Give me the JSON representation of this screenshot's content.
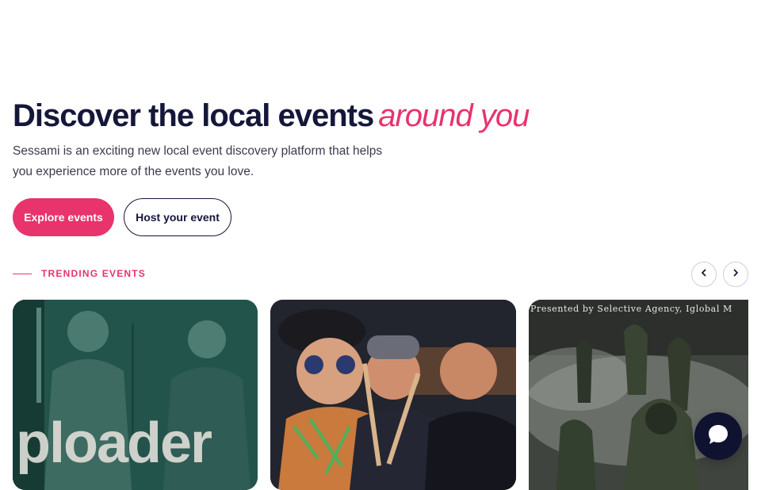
{
  "hero": {
    "title_main": "Discover the local events",
    "title_accent": "around you",
    "description": "Sessami is an exciting new local event discovery platform that helps you experience more of the events you love."
  },
  "actions": {
    "explore_label": "Explore events",
    "host_label": "Host your event"
  },
  "trending": {
    "label": "TRENDING EVENTS",
    "prev_icon": "chevron-left-icon",
    "next_icon": "chevron-right-icon",
    "cards": [
      {
        "image": "band-performance-photo",
        "overlay_text": "ploader"
      },
      {
        "image": "punk-band-photo"
      },
      {
        "image": "dark-poster-image",
        "poster_text": "Presented by Selective Agency, Iglobal M"
      }
    ]
  },
  "chat": {
    "icon": "chat-bubble-icon"
  },
  "colors": {
    "accent": "#e8336d",
    "primary_text": "#15173a",
    "chat_bg": "#0f1330"
  }
}
